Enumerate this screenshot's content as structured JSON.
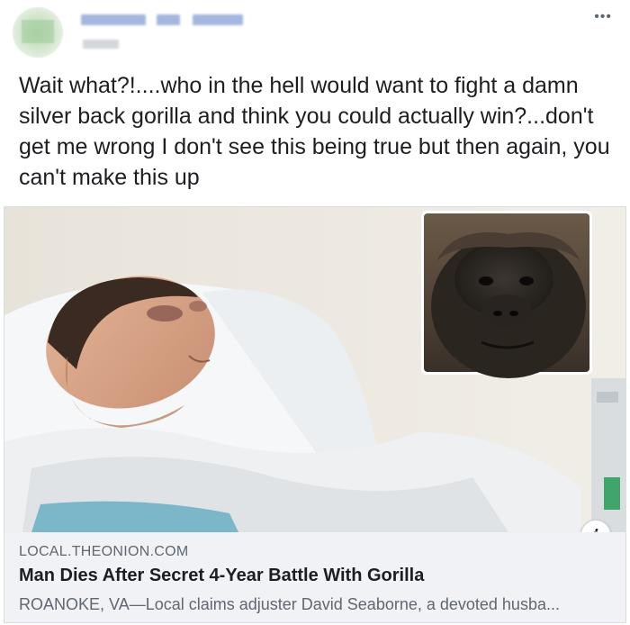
{
  "post": {
    "author_name_blurred": "Eobel Pebble",
    "text": "Wait what?!....who in the hell would want to fight a damn silver back gorilla and think you could actually win?...don't get me wrong I don't see this being true but then again, you can't make this up",
    "more_icon": "more-horizontal-icon"
  },
  "link": {
    "domain": "LOCAL.THEONION.COM",
    "headline": "Man Dies After Secret 4-Year Battle With Gorilla",
    "description": "ROANOKE, VA—Local claims adjuster David Seaborne, a devoted husba...",
    "info_icon": "info-icon",
    "info_glyph": "i"
  },
  "colors": {
    "text": "#1c1e21",
    "secondary_text": "#606770",
    "card_bg": "#f0f2f5",
    "border": "#dadde1"
  }
}
